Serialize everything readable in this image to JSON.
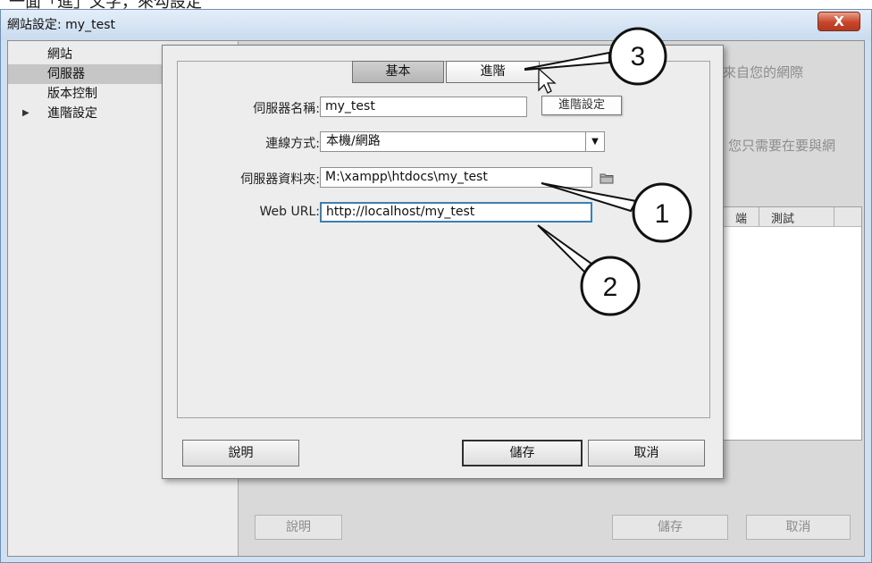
{
  "top_text": "一面「進」文字，來勾設定",
  "window": {
    "title": "網站設定: my_test",
    "close_label": "X"
  },
  "sidebar": {
    "items": [
      {
        "label": "網站",
        "selected": false,
        "expandable": false
      },
      {
        "label": "伺服器",
        "selected": true,
        "expandable": false
      },
      {
        "label": "版本控制",
        "selected": false,
        "expandable": false
      },
      {
        "label": "進階設定",
        "selected": false,
        "expandable": true,
        "arrow": "▶"
      }
    ]
  },
  "background": {
    "text1": "來自您的網際",
    "text2": "您只需要在要與網",
    "table_headers": [
      "端",
      "測試"
    ],
    "help_button": "說明",
    "save_button": "儲存",
    "cancel_button": "取消"
  },
  "dialog": {
    "tabs": [
      {
        "label": "基本",
        "active": true
      },
      {
        "label": "進階",
        "active": false
      }
    ],
    "tooltip": "進階設定",
    "fields": {
      "server_name": {
        "label": "伺服器名稱:",
        "value": "my_test"
      },
      "connection": {
        "label": "連線方式:",
        "value": "本機/網路"
      },
      "server_folder": {
        "label": "伺服器資料夾:",
        "value": "M:\\xampp\\htdocs\\my_test"
      },
      "web_url": {
        "label": "Web URL:",
        "value": "http://localhost/my_test"
      }
    },
    "buttons": {
      "help": "說明",
      "save": "儲存",
      "cancel": "取消"
    }
  },
  "callouts": [
    "1",
    "2",
    "3"
  ],
  "colors": {
    "title_gradient_top": "#e4eef9",
    "close_button": "#c8452a",
    "url_focus_border": "#3c7fb1",
    "selected_sidebar": "#c6c6c6"
  }
}
